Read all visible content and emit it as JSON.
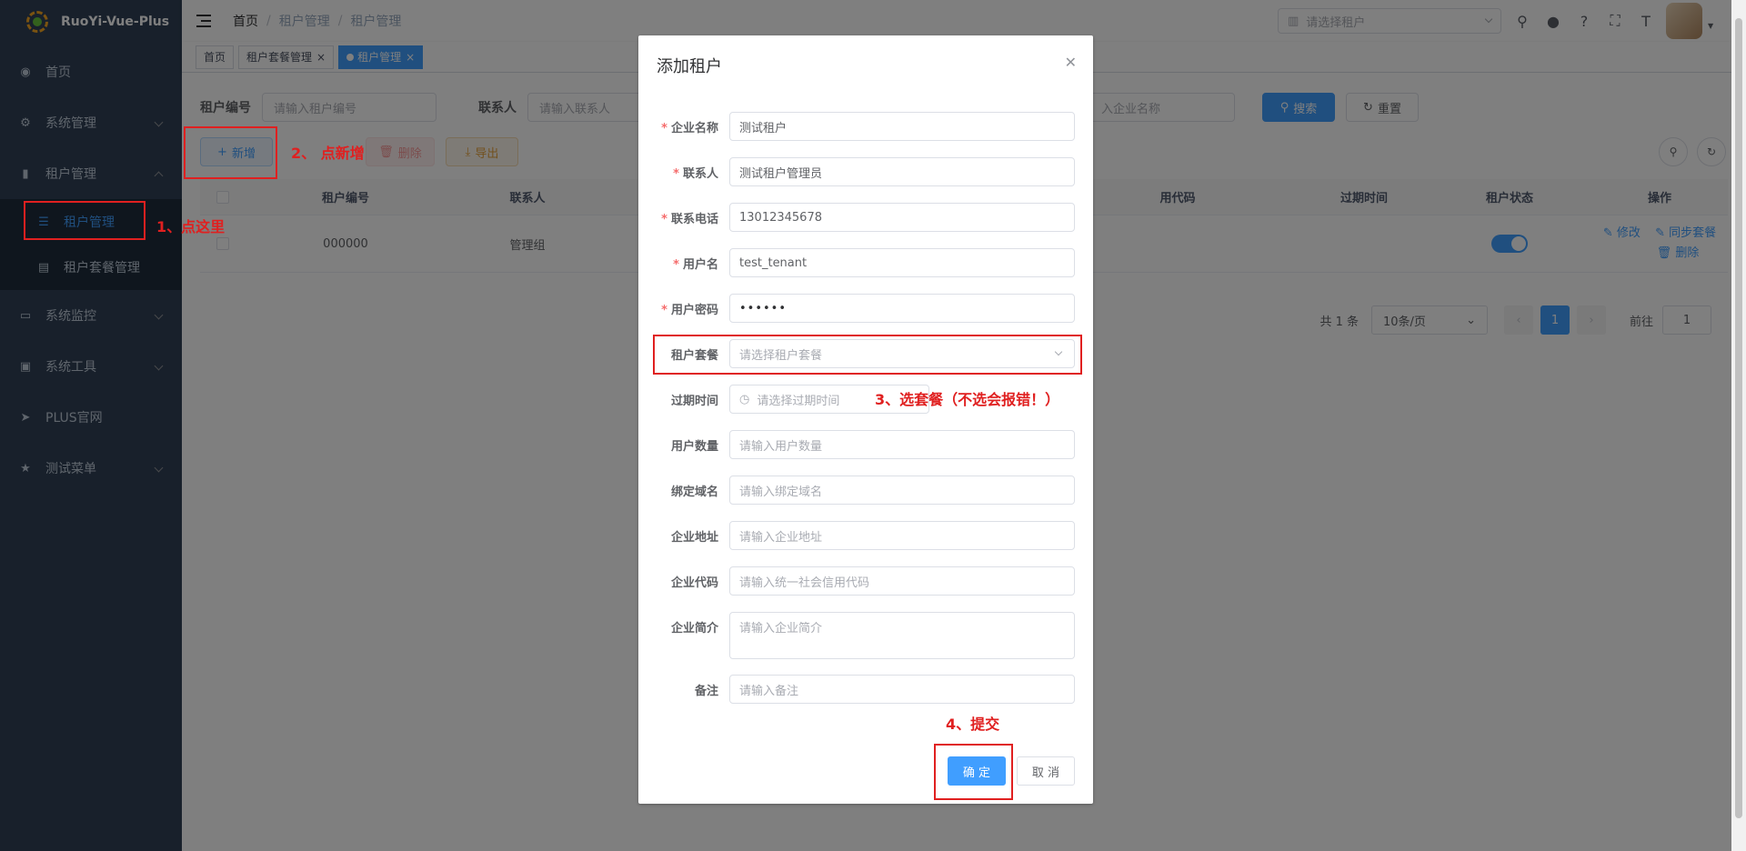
{
  "app": {
    "title": "RuoYi-Vue-Plus"
  },
  "sidebar": {
    "items": [
      {
        "label": "首页",
        "icon": "dashboard-icon"
      },
      {
        "label": "系统管理",
        "icon": "gear-icon"
      },
      {
        "label": "租户管理",
        "icon": "chart-icon"
      },
      {
        "label": "系统监控",
        "icon": "monitor-icon"
      },
      {
        "label": "系统工具",
        "icon": "toolbox-icon"
      },
      {
        "label": "PLUS官网",
        "icon": "send-icon"
      },
      {
        "label": "测试菜单",
        "icon": "star-icon"
      }
    ],
    "tenant_submenu": [
      {
        "label": "租户管理",
        "icon": "list-icon"
      },
      {
        "label": "租户套餐管理",
        "icon": "package-icon"
      }
    ]
  },
  "navbar": {
    "breadcrumb": [
      "首页",
      "租户管理",
      "租户管理"
    ],
    "tenant_placeholder": "请选择租户",
    "icons": [
      "search-icon",
      "github-icon",
      "help-icon",
      "fullscreen-icon",
      "font-size-icon"
    ]
  },
  "tags": [
    "首页",
    "租户套餐管理",
    "租户管理"
  ],
  "search": {
    "tenant_id_label": "租户编号",
    "tenant_id_placeholder": "请输入租户编号",
    "contact_label": "联系人",
    "contact_placeholder": "请输入联系人",
    "company_placeholder": "入企业名称",
    "search_btn": "搜索",
    "reset_btn": "重置"
  },
  "toolbar": {
    "add": "新增",
    "delete": "删除",
    "export": "导出"
  },
  "table": {
    "headers": [
      "租户编号",
      "联系人",
      "用代码",
      "过期时间",
      "租户状态",
      "操作"
    ],
    "row": {
      "tenant_id": "000000",
      "contact": "管理组",
      "status_on": true
    },
    "actions": {
      "edit": "修改",
      "sync": "同步套餐",
      "delete": "删除"
    }
  },
  "pagination": {
    "total": "共 1 条",
    "page_size": "10条/页",
    "current": "1",
    "goto_label": "前往",
    "goto_value": "1"
  },
  "dialog": {
    "title": "添加租户",
    "fields": {
      "company_name": {
        "label": "企业名称",
        "value": "测试租户"
      },
      "contact_user": {
        "label": "联系人",
        "value": "测试租户管理员"
      },
      "contact_phone": {
        "label": "联系电话",
        "value": "13012345678"
      },
      "username": {
        "label": "用户名",
        "value": "test_tenant"
      },
      "password": {
        "label": "用户密码",
        "value": "••••••"
      },
      "package": {
        "label": "租户套餐",
        "placeholder": "请选择租户套餐"
      },
      "expire_time": {
        "label": "过期时间",
        "placeholder": "请选择过期时间"
      },
      "account_count": {
        "label": "用户数量",
        "placeholder": "请输入用户数量"
      },
      "domain": {
        "label": "绑定域名",
        "placeholder": "请输入绑定域名"
      },
      "address": {
        "label": "企业地址",
        "placeholder": "请输入企业地址"
      },
      "license": {
        "label": "企业代码",
        "placeholder": "请输入统一社会信用代码"
      },
      "intro": {
        "label": "企业简介",
        "placeholder": "请输入企业简介"
      },
      "remark": {
        "label": "备注",
        "placeholder": "请输入备注"
      }
    },
    "confirm": "确 定",
    "cancel": "取 消"
  },
  "annotations": {
    "step1": "1、点这里",
    "step2": "2、 点新增",
    "step3": "3、选套餐（不选会报错！）",
    "step4": "4、提交"
  },
  "colors": {
    "sidebar": "#304156",
    "primary": "#409eff",
    "annotation": "#e02020"
  }
}
